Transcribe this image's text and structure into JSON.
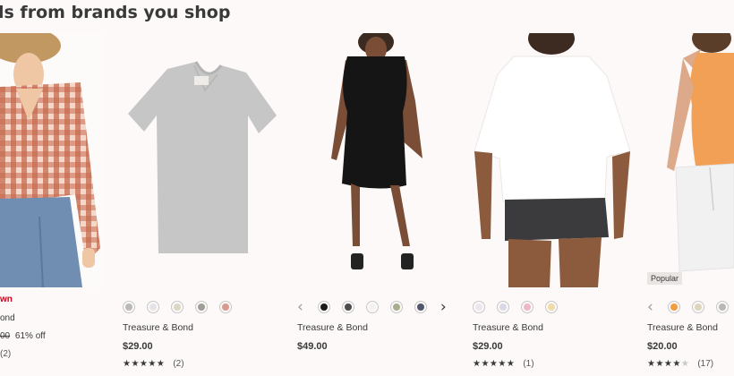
{
  "section": {
    "title": "ls from brands you shop"
  },
  "products": [
    {
      "sale_label": "wn",
      "brand": "ond",
      "original_price": "00",
      "discount": "61% off",
      "review_count": "(2)"
    },
    {
      "brand": "Treasure & Bond",
      "price": "$29.00",
      "rating": 5,
      "review_count": "(2)",
      "swatches": [
        "#b9b9b9",
        "#e6e3e8",
        "#ddd6c2",
        "#9e9f96",
        "#d79a8f"
      ]
    },
    {
      "brand": "Treasure & Bond",
      "price": "$49.00",
      "swatches": [
        "#1b1b1b",
        "#4c4c4e",
        "#f3f2f2",
        "#a7ae8e",
        "#50566b"
      ]
    },
    {
      "brand": "Treasure & Bond",
      "price": "$29.00",
      "rating": 5,
      "review_count": "(1)",
      "swatches": [
        "#ece6ef",
        "#d9d8ea",
        "#efb7c5",
        "#efdca8"
      ]
    },
    {
      "badge": "Popular",
      "brand": "Treasure & Bond",
      "price": "$20.00",
      "rating": 4,
      "review_count": "(17)",
      "swatches": [
        "#f29d42",
        "#ddd6bf",
        "#b8b9b4"
      ]
    }
  ],
  "icons": {
    "prev": "chevron-left-icon",
    "next": "chevron-right-icon",
    "star": "star-icon"
  }
}
